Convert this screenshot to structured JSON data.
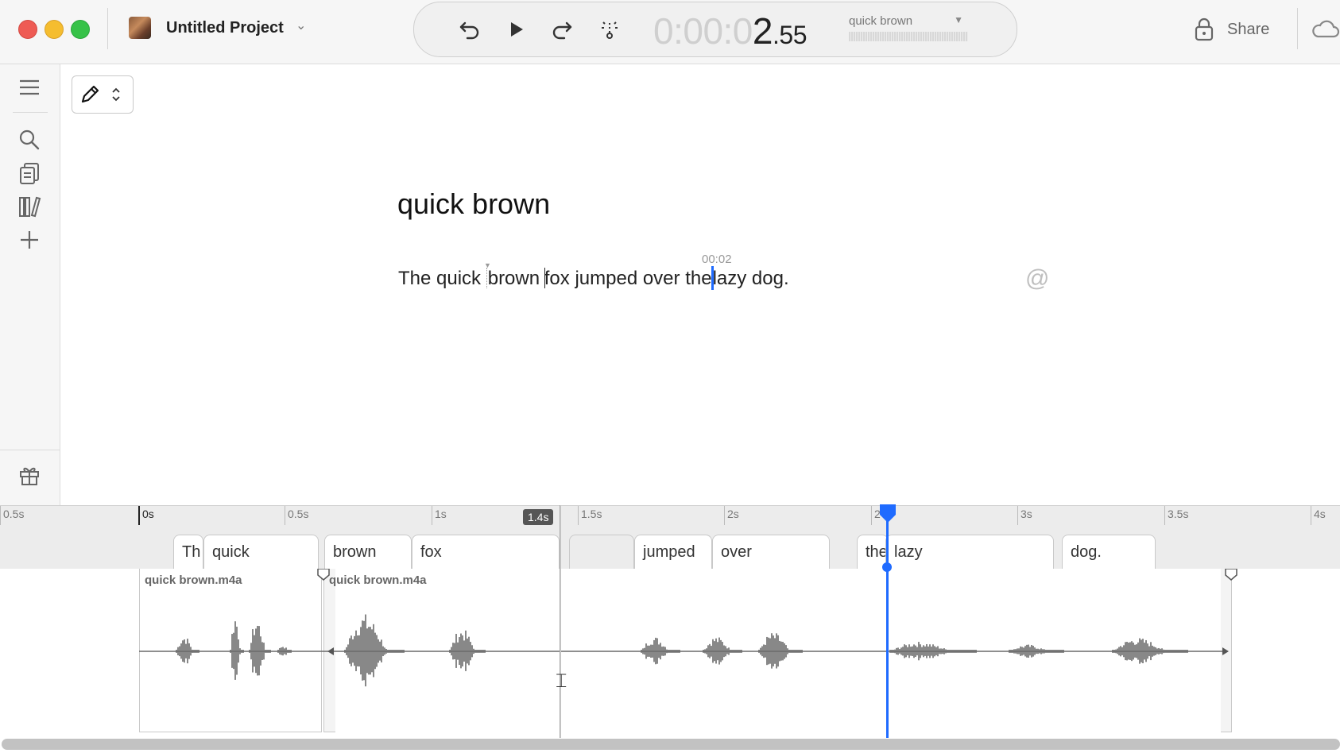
{
  "window": {
    "project_title": "Untitled Project",
    "share_label": "Share"
  },
  "transport": {
    "timecode_dim": "0:00:0",
    "timecode_main": "2",
    "timecode_frac": ".55",
    "scene_label": "quick brown"
  },
  "editor": {
    "title": "quick brown",
    "words": [
      "The quick ",
      "brown ",
      "fox jumped over the",
      "lazy dog."
    ],
    "word_time": "00:02",
    "mention_symbol": "@"
  },
  "timeline": {
    "ruler_labels": [
      "0.5s",
      "0s",
      "0.5s",
      "1s",
      "1.5s",
      "2s",
      "2",
      "3s",
      "3.5s",
      "4s"
    ],
    "selection_badge": "1.4s",
    "word_blocks": [
      "Th",
      "quick",
      "brown",
      "fox",
      "jumped",
      "over",
      "the",
      "lazy",
      "dog."
    ],
    "clips": [
      "quick brown.m4a",
      "quick brown.m4a"
    ]
  },
  "colors": {
    "accent": "#1f6bff",
    "close": "#ee5b54",
    "minimize": "#f5bd2f",
    "maximize": "#36c248"
  }
}
